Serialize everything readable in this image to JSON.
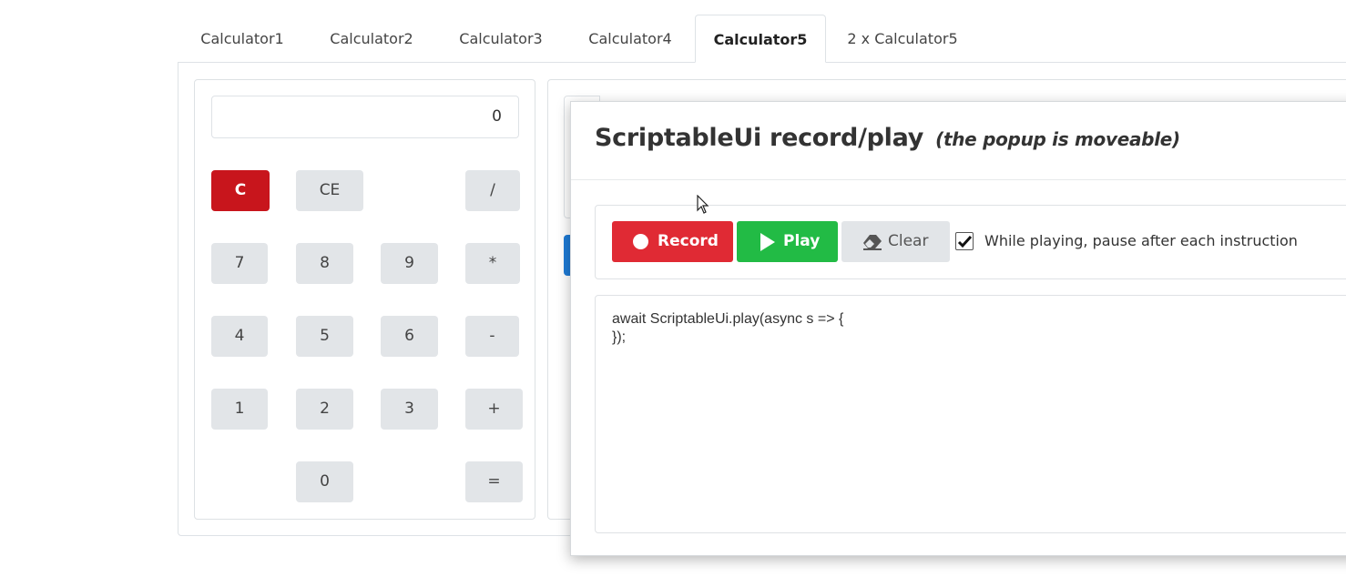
{
  "tabs": [
    {
      "label": "Calculator1",
      "active": false
    },
    {
      "label": "Calculator2",
      "active": false
    },
    {
      "label": "Calculator3",
      "active": false
    },
    {
      "label": "Calculator4",
      "active": false
    },
    {
      "label": "Calculator5",
      "active": true
    },
    {
      "label": "2 x Calculator5",
      "active": false
    }
  ],
  "calculator": {
    "display": "0",
    "keys": {
      "c": "C",
      "ce": "CE",
      "divide": "/",
      "k7": "7",
      "k8": "8",
      "k9": "9",
      "multiply": "*",
      "k4": "4",
      "k5": "5",
      "k6": "6",
      "minus": "-",
      "k1": "1",
      "k2": "2",
      "k3": "3",
      "plus": "+",
      "k0": "0",
      "equals": "="
    }
  },
  "popup": {
    "title": "ScriptableUi record/play",
    "subtitle": "(the popup is moveable)",
    "record_label": "Record",
    "play_label": "Play",
    "clear_label": "Clear",
    "pause_checkbox_checked": true,
    "pause_label": "While playing, pause after each instruction",
    "code_line_1": "await ScriptableUi.play(async s => {",
    "code_line_2": "});"
  },
  "colors": {
    "record": "#e02a34",
    "play": "#22bb45",
    "clear": "#e2e5e8",
    "clear_key": "#c8151c",
    "key": "#e2e5e8"
  },
  "icons": {
    "record": "record-dot-icon",
    "play": "play-triangle-icon",
    "clear": "eraser-icon",
    "checkbox": "checkmark-icon",
    "mouse": "mouse-pointer-icon"
  }
}
